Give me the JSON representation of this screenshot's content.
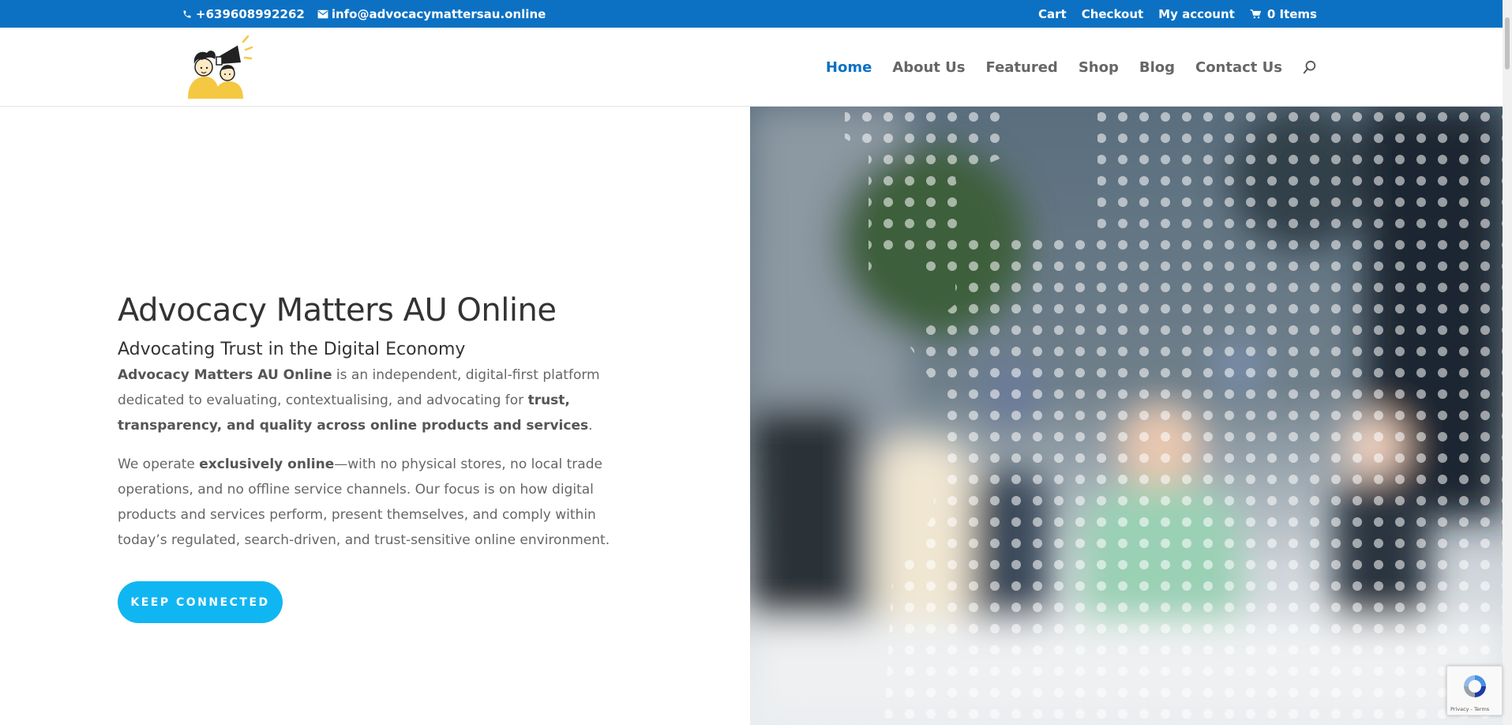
{
  "topbar": {
    "phone": "+639608992262",
    "email": "info@advocacymattersau.online",
    "links": [
      "Cart",
      "Checkout",
      "My account"
    ],
    "cart_items": "0 Items",
    "bg_color": "#0c71c3"
  },
  "nav": {
    "items": [
      {
        "label": "Home",
        "active": true
      },
      {
        "label": "About Us"
      },
      {
        "label": "Featured"
      },
      {
        "label": "Shop"
      },
      {
        "label": "Blog"
      },
      {
        "label": "Contact Us"
      }
    ],
    "active_color": "#0c71c3"
  },
  "hero": {
    "title": "Advocacy Matters AU Online",
    "subtitle": "Advocating Trust in the Digital Economy",
    "p1": {
      "strong_1": "Advocacy Matters AU Online",
      "text_1": " is an independent, digital-first platform dedicated to evaluating, contextualising, and advocating for ",
      "strong_2": "trust, transparency, and quality across online products and services",
      "text_2": "."
    },
    "p2": {
      "text_1": "We operate ",
      "strong_1": "exclusively online",
      "text_2": "—with no physical stores, no local trade operations, and no offline service channels. Our focus is on how digital products and services perform, present themselves, and comply within today’s regulated, search-driven, and trust-sensitive online environment."
    },
    "cta_label": "KEEP CONNECTED",
    "cta_color": "#10b6f2"
  },
  "recaptcha": {
    "privacy": "Privacy",
    "terms": "Terms"
  },
  "icons": {
    "phone": "phone-icon",
    "email": "envelope-icon",
    "cart": "cart-icon",
    "search": "search-icon",
    "recaptcha": "recaptcha-icon"
  }
}
